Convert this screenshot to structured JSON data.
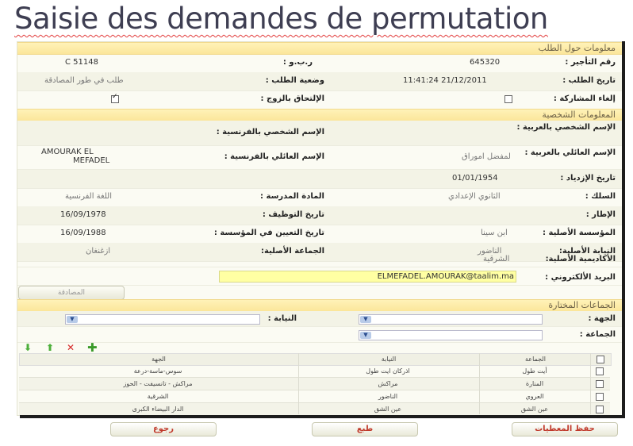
{
  "page": {
    "title": "Saisie des demandes de permutation"
  },
  "sections": {
    "request_info": "معلومات حول الطلب",
    "personal_info": "المعلومات الشخصية",
    "chosen": "الجماعات المختارة"
  },
  "request": {
    "rank_label": "رقم التأجير :",
    "rank_value": "645320",
    "rbo_label": "ر.ب.و :",
    "rbo_value": "C   51148",
    "date_label": "تاريخ الطلب :",
    "date_value": "11:41:24 21/12/2011",
    "status_label": "وضعية الطلب :",
    "status_value": "طلب في طور المصادقة",
    "cancel_label": "إلغاء المشاركة :",
    "spouse_label": "الإلتحاق بالزوج :"
  },
  "personal": {
    "fname_ar_label": "الإسم الشخصي بالعربية :",
    "fname_fr_label": "الإسم الشخصي بالفرنسية :",
    "lname_ar_label": "الإسم العائلي بالعربية :",
    "lname_ar_value": "لمفضل اموراق",
    "lname_fr_label": "الإسم العائلي بالفرنسية :",
    "lname_fr_value_1": "AMOURAK EL",
    "lname_fr_value_2": "MEFADEL",
    "birth_label": "تاريخ الإزدياد :",
    "birth_value": "01/01/1954",
    "corps_label": "السلك :",
    "corps_value": "الثانوي الإعدادي",
    "subject_label": "المادة المدرسة :",
    "subject_value": "اللغة الفرنسية",
    "frame_label": "الإطار :",
    "hire_label": "تاريخ التوظيف :",
    "hire_value": "16/09/1978",
    "school_label": "المؤسسة الأصلية :",
    "school_value": "ابن سينا",
    "appoint_label": "تاريخ التعيين في المؤسسة :",
    "appoint_value": "16/09/1988",
    "delegation_label": "النيابة الأصلية:",
    "delegation_value": "الناضور",
    "commune_label": "الجماعة الأصلية:",
    "commune_value": "ازغنغان",
    "academy_label": "الأكاديمية الأصلية:",
    "academy_value": "الشرقية",
    "email_label": "البريد الألكتروني :",
    "email_value": "ELMEFADEL.AMOURAK@taalim.ma",
    "validate_button": "المصادقة"
  },
  "chosen": {
    "region_label": "الجهة :",
    "delegation_label": "النيابة :",
    "commune_label": "الجماعة :"
  },
  "grid": {
    "headers": {
      "commune": "الجماعة",
      "delegation": "النيابة",
      "region": "الجهة"
    },
    "rows": [
      {
        "commune": "أيت طول",
        "delegation": "اذركان ايت طول",
        "region": "سوس-ماسة-درعة"
      },
      {
        "commune": "المنارة",
        "delegation": "مراكش",
        "region": "مراكش - تانسيفت - الحوز"
      },
      {
        "commune": "العروي",
        "delegation": "الناضور",
        "region": "الشرقية"
      },
      {
        "commune": "عين الشق",
        "delegation": "عين الشق",
        "region": "الدار البيضاء الكبرى"
      }
    ]
  },
  "footer": {
    "save": "حفظ المعطيات",
    "print": "طبع",
    "back": "رجوع"
  },
  "colors": {
    "accent": "#c0392b",
    "section": "#fbe69a",
    "email_bg": "#ffffa3"
  },
  "icons": [
    "arrow-down-icon",
    "arrow-up-icon",
    "delete-icon",
    "add-icon"
  ]
}
